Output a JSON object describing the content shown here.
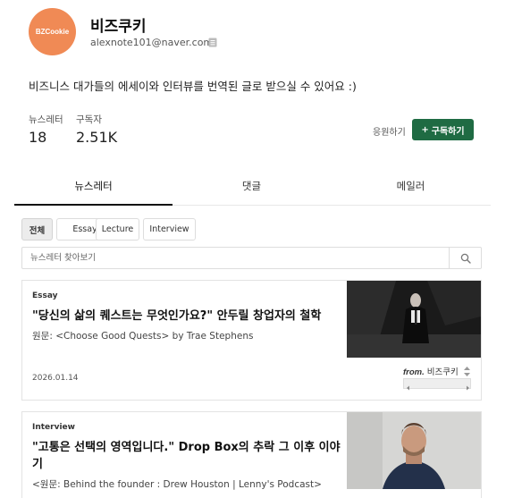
{
  "header": {
    "logo_text": "BZCookie",
    "name": "비즈쿠키",
    "email": "alexnote101@naver.com",
    "copy_icon": "copy-icon",
    "brand_color": "#f08a55"
  },
  "description": "비즈니스 대가들의 에세이와 인터뷰를 번역된 글로 받으실 수 있어요 :)",
  "stats": [
    {
      "label": "뉴스레터",
      "value": "18"
    },
    {
      "label": "구독자",
      "value": "2.51K"
    }
  ],
  "actions": {
    "support_label": "응원하기",
    "subscribe_icon": "+",
    "subscribe_label": "구독하기",
    "subscribe_color": "#1f6b43"
  },
  "tabs": [
    {
      "label": "뉴스레터",
      "active": true
    },
    {
      "label": "댓글",
      "active": false
    },
    {
      "label": "메일러",
      "active": false
    }
  ],
  "filters": [
    {
      "label": "전체",
      "active": true
    },
    {
      "label": "Essay",
      "active": false
    },
    {
      "label": "Lecture",
      "active": false
    },
    {
      "label": "Interview",
      "active": false
    }
  ],
  "search": {
    "placeholder": "뉴스레터 찾아보기",
    "icon": "search-icon"
  },
  "posts": [
    {
      "category": "Essay",
      "title": "\"당신의 삶의 퀘스트는 무엇인가요?\" 안두릴 창업자의 철학",
      "subtitle": "원문: <Choose Good Quests> by Trae Stephens",
      "date": "2026.01.14",
      "from_label": "from.",
      "from_name": "비즈쿠키"
    },
    {
      "category": "Interview",
      "title": "\"고통은 선택의 영역입니다.\" Drop Box의 추락 그 이후 이야기",
      "subtitle": "<원문: Behind the founder : Drew Houston | Lenny's Podcast>"
    }
  ]
}
